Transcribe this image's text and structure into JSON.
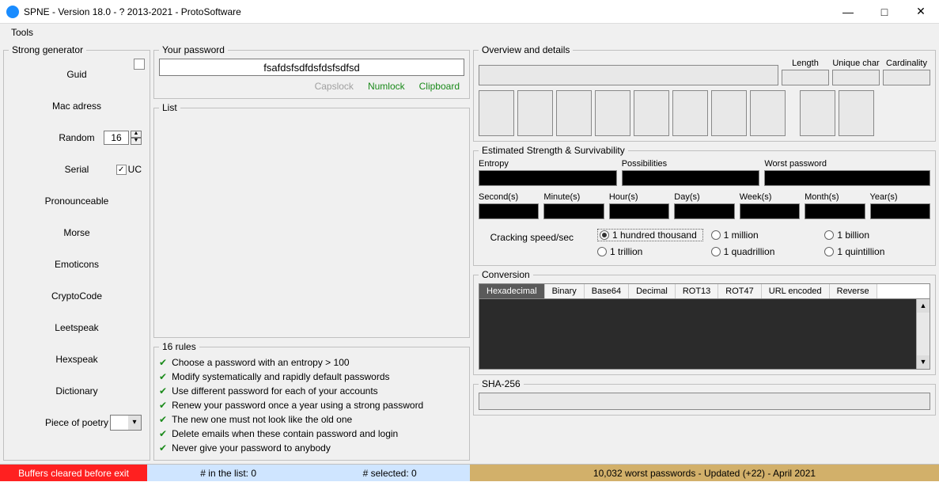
{
  "window": {
    "title": "SPNE - Version 18.0 - ? 2013-2021 - ProtoSoftware"
  },
  "menu": {
    "tools": "Tools"
  },
  "generator": {
    "legend": "Strong generator",
    "items": [
      "Guid",
      "Mac adress",
      "Random",
      "Serial",
      "Pronounceable",
      "Morse",
      "Emoticons",
      "CryptoCode",
      "Leetspeak",
      "Hexspeak",
      "Dictionary",
      "Piece of poetry"
    ],
    "random_value": "16",
    "uc_label": "UC"
  },
  "password": {
    "legend": "Your password",
    "value": "fsafdsfsdfdsfdsfsdfsd",
    "indicators": {
      "capslock": "Capslock",
      "numlock": "Numlock",
      "clipboard": "Clipboard"
    }
  },
  "list": {
    "legend": "List"
  },
  "rules": {
    "legend": "16 rules",
    "items": [
      "Choose a password with an entropy > 100",
      "Modify systematically and rapidly default passwords",
      "Use different password for each of your accounts",
      "Renew your password once a year using a strong password",
      "The new one must not look like the old one",
      "Delete emails when these contain password and login",
      "Never give your password to anybody"
    ]
  },
  "overview": {
    "legend": "Overview and details",
    "labels": {
      "length": "Length",
      "unique": "Unique char",
      "cardinality": "Cardinality"
    }
  },
  "strength": {
    "legend": "Estimated Strength & Survivability",
    "entropy": "Entropy",
    "possibilities": "Possibilities",
    "worst": "Worst password",
    "units": [
      "Second(s)",
      "Minute(s)",
      "Hour(s)",
      "Day(s)",
      "Week(s)",
      "Month(s)",
      "Year(s)"
    ],
    "speed_label": "Cracking speed/sec",
    "speeds": [
      "1 hundred thousand",
      "1 million",
      "1 billion",
      "1 trillion",
      "1 quadrillion",
      "1 quintillion"
    ]
  },
  "conversion": {
    "legend": "Conversion",
    "tabs": [
      "Hexadecimal",
      "Binary",
      "Base64",
      "Decimal",
      "ROT13",
      "ROT47",
      "URL encoded",
      "Reverse"
    ]
  },
  "sha": {
    "legend": "SHA-256"
  },
  "status": {
    "red": "Buffers cleared before exit",
    "blue1": "# in the list: 0",
    "blue2": "# selected: 0",
    "tan": "10,032 worst passwords - Updated (+22) - April 2021"
  }
}
